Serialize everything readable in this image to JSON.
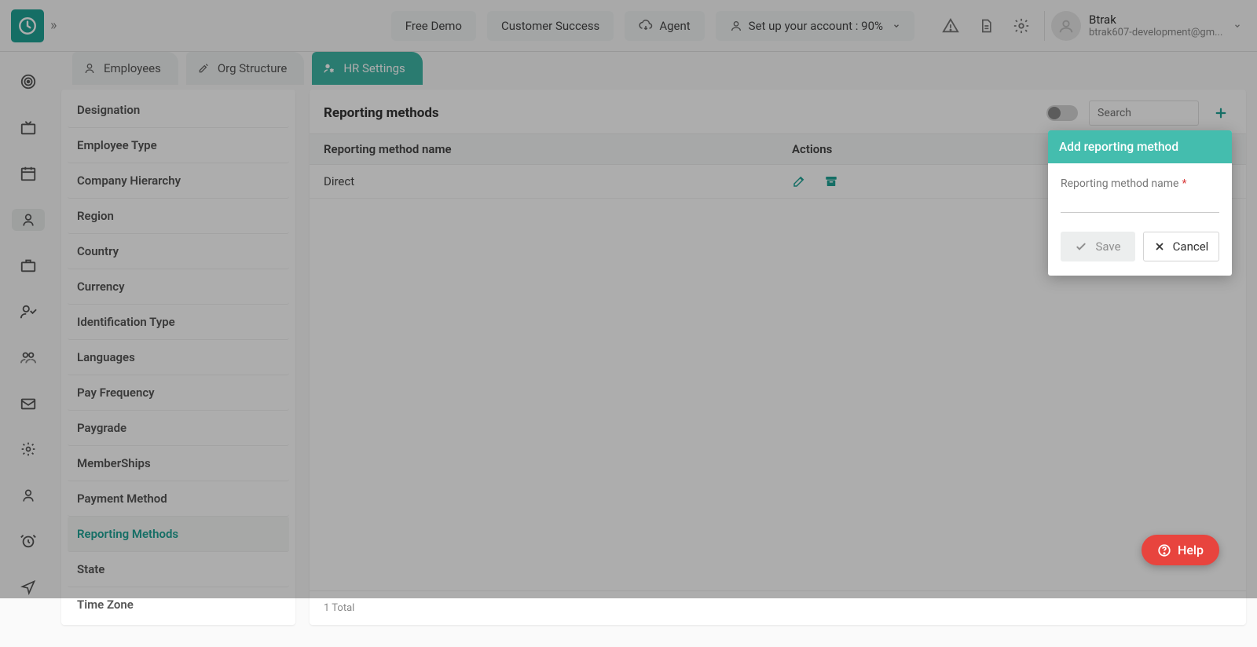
{
  "header": {
    "free_demo": "Free Demo",
    "customer_success": "Customer Success",
    "agent": "Agent",
    "setup_account": "Set up your account : 90%",
    "user_name": "Btrak",
    "user_email": "btrak607-development@gm..."
  },
  "tabs": {
    "employees": "Employees",
    "org_structure": "Org Structure",
    "hr_settings": "HR Settings"
  },
  "settings_items": [
    "Designation",
    "Employee Type",
    "Company Hierarchy",
    "Region",
    "Country",
    "Currency",
    "Identification Type",
    "Languages",
    "Pay Frequency",
    "Paygrade",
    "MemberShips",
    "Payment Method",
    "Reporting Methods",
    "State",
    "Time Zone"
  ],
  "settings_active_index": 12,
  "content": {
    "title": "Reporting methods",
    "search_placeholder": "Search",
    "col_name": "Reporting method name",
    "col_actions": "Actions",
    "rows": [
      {
        "name": "Direct"
      }
    ],
    "footer_total": "1 Total"
  },
  "popover": {
    "title": "Add reporting method",
    "field_label": "Reporting method name",
    "required_mark": "*",
    "save": "Save",
    "cancel": "Cancel"
  },
  "help": {
    "label": "Help"
  }
}
